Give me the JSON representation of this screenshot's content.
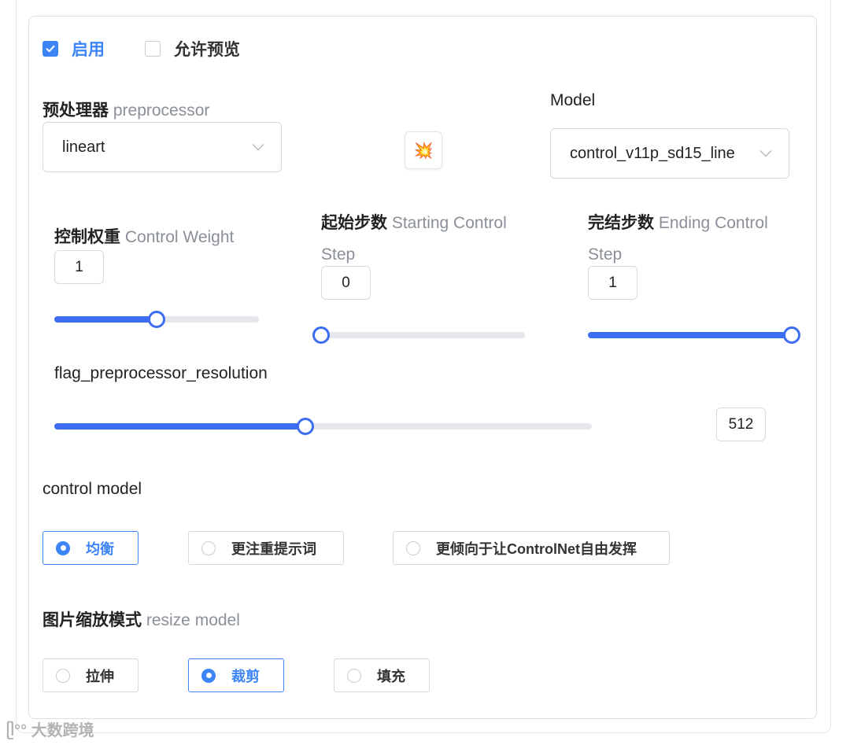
{
  "checkboxes": {
    "enable": {
      "label": "启用",
      "checked": true
    },
    "allow_preview": {
      "label": "允许预览",
      "checked": false
    }
  },
  "preprocessor": {
    "label_cn": "预处理器",
    "label_en": "preprocessor",
    "value": "lineart"
  },
  "run_button": {
    "icon": "explosion-icon",
    "glyph": "💥"
  },
  "model": {
    "label": "Model",
    "value": "control_v11p_sd15_line"
  },
  "control_weight": {
    "label_cn": "控制权重",
    "label_en": "Control Weight",
    "value": "1",
    "fraction": 0.5
  },
  "starting_step": {
    "label_cn": "起始步数",
    "label_en": "Starting Control Step",
    "value": "0",
    "fraction": 0.0
  },
  "ending_step": {
    "label_cn": "完结步数",
    "label_en": "Ending Control Step",
    "value": "1",
    "fraction": 1.0
  },
  "resolution": {
    "label": "flag_preprocessor_resolution",
    "value": "512",
    "fraction": 0.467
  },
  "control_mode": {
    "label": "control model",
    "options": [
      "均衡",
      "更注重提示词",
      "更倾向于让ControlNet自由发挥"
    ],
    "selected_index": 0
  },
  "resize_mode": {
    "label_cn": "图片缩放模式",
    "label_en": "resize model",
    "options": [
      "拉伸",
      "裁剪",
      "填充"
    ],
    "selected_index": 1
  },
  "watermark": "大数跨境",
  "colors": {
    "accent": "#3d84f7",
    "slider": "#3d6df0",
    "muted": "#8a8f98"
  }
}
